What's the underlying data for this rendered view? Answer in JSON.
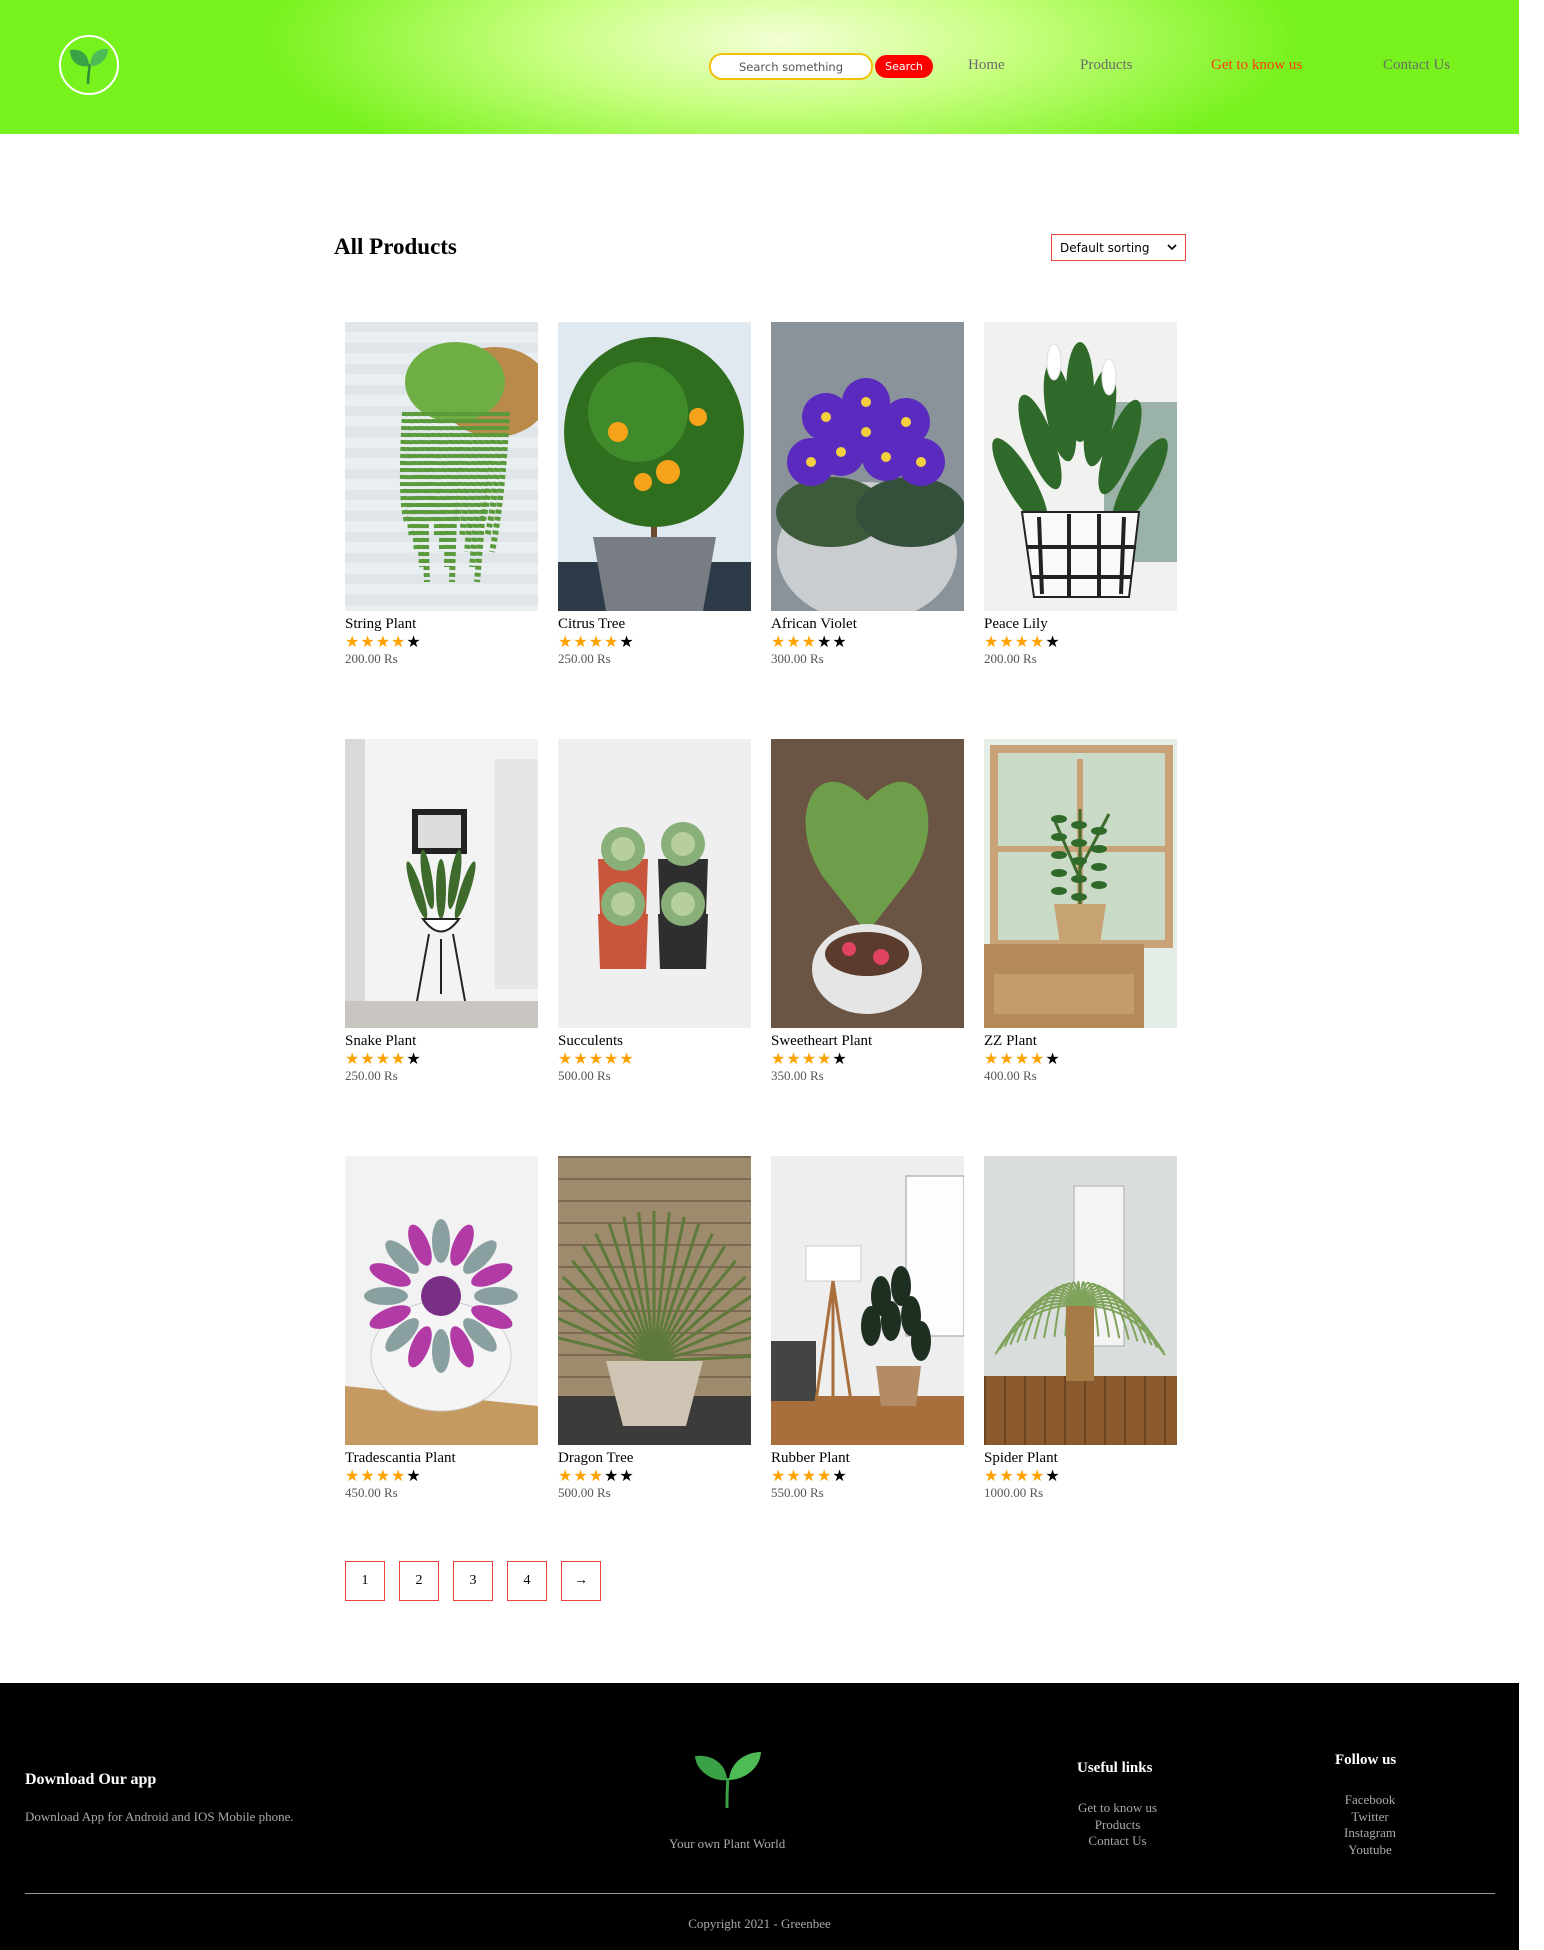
{
  "header": {
    "search": {
      "placeholder": "Search something",
      "button_label": "Search"
    },
    "nav": [
      {
        "label": "Home"
      },
      {
        "label": "Products"
      },
      {
        "label": "Get to know us",
        "active": true
      },
      {
        "label": "Contact Us"
      }
    ],
    "colors": {
      "header_green": "#77f21c",
      "accent_red": "#ff0000",
      "active_link": "#ff3a0f"
    }
  },
  "main": {
    "title": "All Products",
    "sort": {
      "selected": "Default sorting"
    },
    "products": [
      {
        "name": "String Plant",
        "rating": 4,
        "max_rating": 5,
        "price": "200.00 Rs",
        "icon": "string-plant-photo"
      },
      {
        "name": "Citrus Tree",
        "rating": 4,
        "max_rating": 5,
        "price": "250.00 Rs",
        "icon": "citrus-tree-photo"
      },
      {
        "name": "African Violet",
        "rating": 3,
        "max_rating": 5,
        "price": "300.00 Rs",
        "icon": "african-violet-photo"
      },
      {
        "name": "Peace Lily",
        "rating": 4,
        "max_rating": 5,
        "price": "200.00 Rs",
        "icon": "peace-lily-photo"
      },
      {
        "name": "Snake Plant",
        "rating": 4,
        "max_rating": 5,
        "price": "250.00 Rs",
        "icon": "snake-plant-photo"
      },
      {
        "name": "Succulents",
        "rating": 5,
        "max_rating": 5,
        "price": "500.00 Rs",
        "icon": "succulents-photo"
      },
      {
        "name": "Sweetheart Plant",
        "rating": 4,
        "max_rating": 5,
        "price": "350.00 Rs",
        "icon": "sweetheart-plant-photo"
      },
      {
        "name": "ZZ Plant",
        "rating": 4,
        "max_rating": 5,
        "price": "400.00 Rs",
        "icon": "zz-plant-photo"
      },
      {
        "name": "Tradescantia Plant",
        "rating": 4,
        "max_rating": 5,
        "price": "450.00 Rs",
        "icon": "tradescantia-photo"
      },
      {
        "name": "Dragon Tree",
        "rating": 3,
        "max_rating": 5,
        "price": "500.00 Rs",
        "icon": "dragon-tree-photo"
      },
      {
        "name": "Rubber Plant",
        "rating": 4,
        "max_rating": 5,
        "price": "550.00 Rs",
        "icon": "rubber-plant-photo"
      },
      {
        "name": "Spider Plant",
        "rating": 4,
        "max_rating": 5,
        "price": "1000.00 Rs",
        "icon": "spider-plant-photo"
      }
    ],
    "pagination": [
      "1",
      "2",
      "3",
      "4",
      "→"
    ]
  },
  "footer": {
    "download_title": "Download Our app",
    "download_text": "Download App for Android and IOS Mobile phone.",
    "tagline": "Your own Plant World",
    "useful_links": {
      "title": "Useful links",
      "items": [
        "Get to know us",
        "Products",
        "Contact Us"
      ]
    },
    "follow": {
      "title": "Follow us",
      "items": [
        "Facebook",
        "Twitter",
        "Instagram",
        "Youtube"
      ]
    },
    "copyright": "Copyright 2021 - Greenbee"
  }
}
